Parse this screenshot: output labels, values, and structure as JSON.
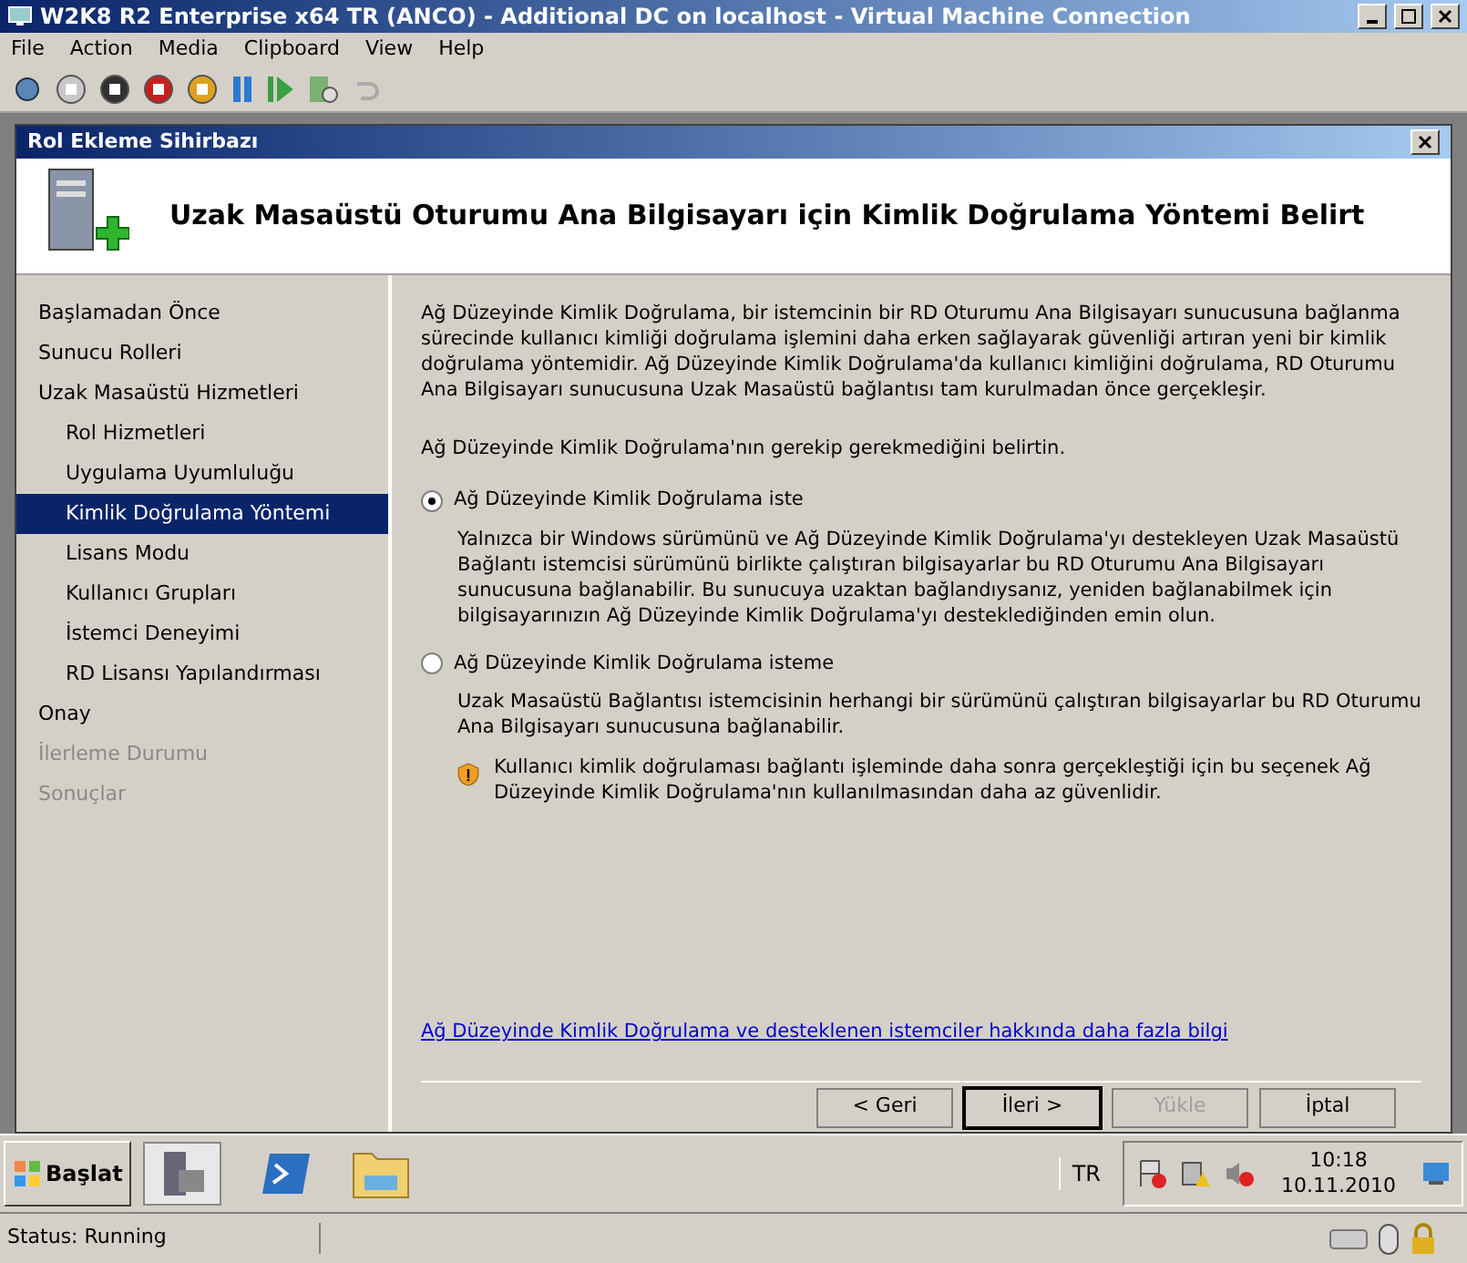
{
  "window": {
    "title": "W2K8 R2 Enterprise x64 TR (ANCO) - Additional DC on localhost - Virtual Machine Connection"
  },
  "menu": [
    "File",
    "Action",
    "Media",
    "Clipboard",
    "View",
    "Help"
  ],
  "wizard": {
    "title": "Rol Ekleme Sihirbazı",
    "heading": "Uzak Masaüstü Oturumu Ana Bilgisayarı için Kimlik Doğrulama Yöntemi Belirt",
    "nav": [
      {
        "label": "Başlamadan Önce",
        "selected": false,
        "disabled": false
      },
      {
        "label": "Sunucu Rolleri",
        "selected": false,
        "disabled": false
      },
      {
        "label": "Uzak Masaüstü Hizmetleri",
        "selected": false,
        "disabled": false,
        "children": [
          {
            "label": "Rol Hizmetleri",
            "selected": false,
            "disabled": false
          },
          {
            "label": "Uygulama Uyumluluğu",
            "selected": false,
            "disabled": false
          },
          {
            "label": "Kimlik Doğrulama Yöntemi",
            "selected": true,
            "disabled": false
          },
          {
            "label": "Lisans Modu",
            "selected": false,
            "disabled": false
          },
          {
            "label": "Kullanıcı Grupları",
            "selected": false,
            "disabled": false
          },
          {
            "label": "İstemci Deneyimi",
            "selected": false,
            "disabled": false
          },
          {
            "label": "RD Lisansı Yapılandırması",
            "selected": false,
            "disabled": false
          }
        ]
      },
      {
        "label": "Onay",
        "selected": false,
        "disabled": false
      },
      {
        "label": "İlerleme Durumu",
        "selected": false,
        "disabled": true
      },
      {
        "label": "Sonuçlar",
        "selected": false,
        "disabled": true
      }
    ],
    "intro": "Ağ Düzeyinde Kimlik Doğrulama, bir istemcinin bir RD Oturumu Ana Bilgisayarı sunucusuna bağlanma sürecinde kullanıcı kimliği doğrulama işlemini daha erken sağlayarak güvenliği artıran yeni bir kimlik doğrulama yöntemidir. Ağ Düzeyinde Kimlik Doğrulama'da kullanıcı kimliğini doğrulama, RD Oturumu Ana Bilgisayarı sunucusuna Uzak Masaüstü bağlantısı tam kurulmadan önce gerçekleşir.",
    "prompt": "Ağ Düzeyinde Kimlik Doğrulama'nın gerekip gerekmediğini belirtin.",
    "options": [
      {
        "label": "Ağ Düzeyinde Kimlik Doğrulama iste",
        "selected": true,
        "description": "Yalnızca bir Windows sürümünü ve Ağ Düzeyinde Kimlik Doğrulama'yı destekleyen Uzak Masaüstü Bağlantı istemcisi sürümünü birlikte çalıştıran bilgisayarlar bu RD Oturumu Ana Bilgisayarı sunucusuna bağlanabilir. Bu sunucuya uzaktan bağlandıysanız, yeniden bağlanabilmek için bilgisayarınızın Ağ Düzeyinde Kimlik Doğrulama'yı desteklediğinden emin olun."
      },
      {
        "label": "Ağ Düzeyinde Kimlik Doğrulama isteme",
        "selected": false,
        "description": "Uzak Masaüstü Bağlantısı istemcisinin herhangi bir sürümünü çalıştıran bilgisayarlar bu RD Oturumu Ana Bilgisayarı sunucusuna bağlanabilir.",
        "warning": "Kullanıcı kimlik doğrulaması bağlantı işleminde daha sonra gerçekleştiği için bu seçenek Ağ Düzeyinde Kimlik Doğrulama'nın kullanılmasından daha az güvenlidir."
      }
    ],
    "link": "Ağ Düzeyinde Kimlik Doğrulama ve desteklenen istemciler hakkında daha fazla bilgi",
    "buttons": [
      {
        "label": "< Geri",
        "disabled": false,
        "default": false
      },
      {
        "label": "İleri >",
        "disabled": false,
        "default": true
      },
      {
        "label": "Yükle",
        "disabled": true,
        "default": false
      },
      {
        "label": "İptal",
        "disabled": false,
        "default": false
      }
    ]
  },
  "taskbar": {
    "start": "Başlat",
    "language": "TR",
    "time": "10:18",
    "date": "10.11.2010"
  },
  "status_bar": {
    "text": "Status: Running"
  }
}
